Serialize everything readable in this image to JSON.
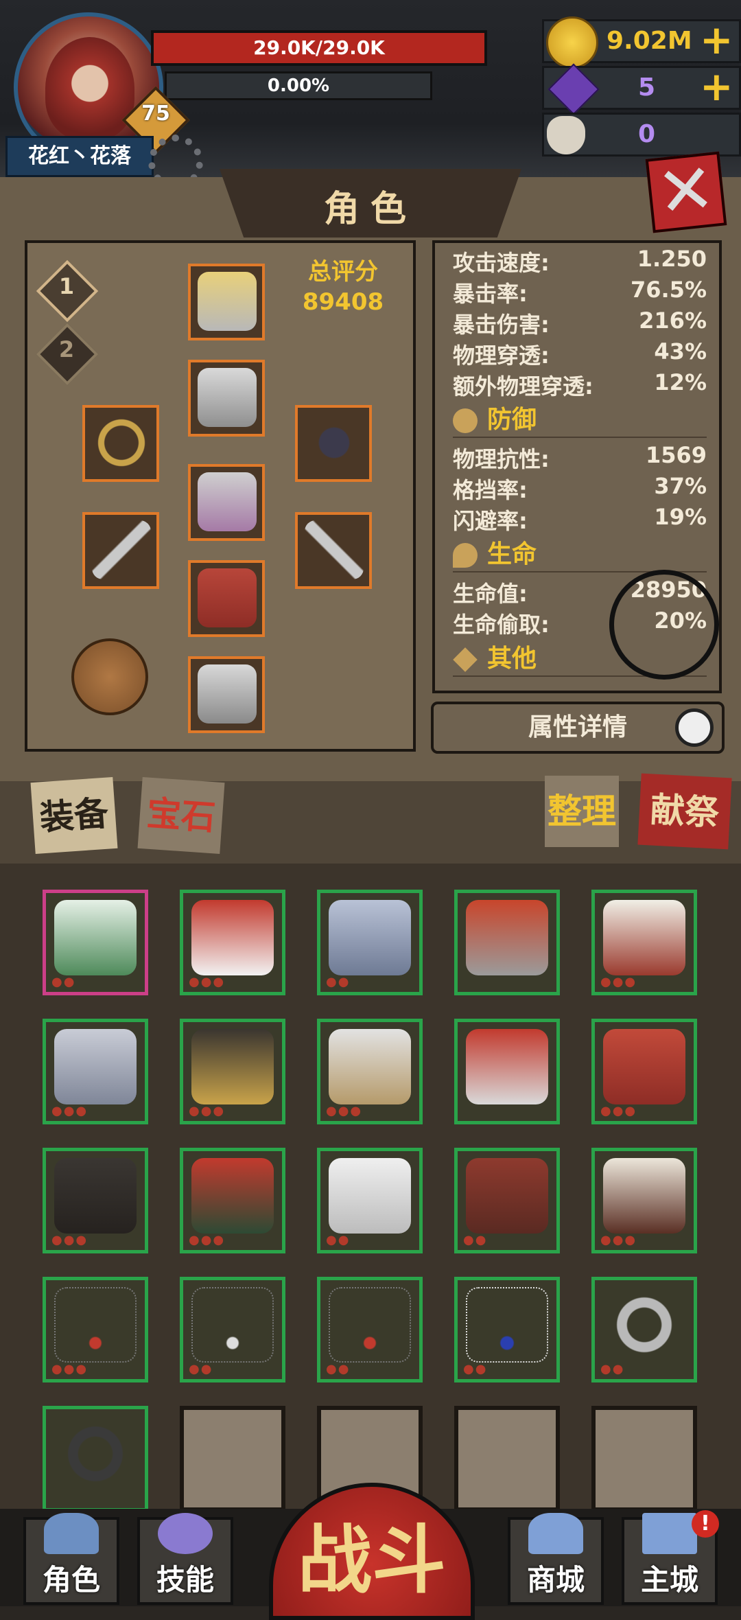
{
  "hud": {
    "player_name": "花红丶花落",
    "level": "75",
    "hp_text": "29.0K/29.0K",
    "xp_text": "0.00%",
    "gold": "9.02M",
    "gems": "5",
    "skulls": "0"
  },
  "panel": {
    "title": "角色",
    "slot_buttons": [
      "1",
      "2"
    ],
    "score_label": "总评分",
    "score_value": "89408"
  },
  "stats": {
    "rows_attack": [
      {
        "label": "攻击速度:",
        "value": "1.250"
      },
      {
        "label": "暴击率:",
        "value": "76.5%"
      },
      {
        "label": "暴击伤害:",
        "value": "216%"
      },
      {
        "label": "物理穿透:",
        "value": "43%"
      },
      {
        "label": "额外物理穿透:",
        "value": "12%"
      }
    ],
    "defense_title": "防御",
    "rows_defense": [
      {
        "label": "物理抗性:",
        "value": "1569"
      },
      {
        "label": "格挡率:",
        "value": "37%"
      },
      {
        "label": "闪避率:",
        "value": "19%"
      }
    ],
    "life_title": "生命",
    "rows_life": [
      {
        "label": "生命值:",
        "value": "28950"
      },
      {
        "label": "生命偷取:",
        "value": "20%"
      }
    ],
    "other_title": "其他",
    "detail_button": "属性详情"
  },
  "tabs": {
    "equip": "装备",
    "gem": "宝石",
    "sort": "整理",
    "sacrifice": "献祭"
  },
  "inventory_icons": [
    "winter-boots-icon",
    "santa-hat-icon",
    "knight-helmet-icon",
    "roman-helmet-icon",
    "red-coat-icon",
    "chainmail-icon",
    "black-jacket-icon",
    "plate-armor-icon",
    "roman-armor-icon",
    "red-belt-icon",
    "black-pants-icon",
    "red-skirt-icon",
    "white-pants-icon",
    "leather-skirt-icon",
    "snow-boots-icon",
    "necklace-icon",
    "necklace-icon",
    "necklace-icon",
    "heart-necklace-icon",
    "diamond-ring-icon",
    "black-ring-icon",
    "",
    "",
    "",
    ""
  ],
  "nav": {
    "role": "角色",
    "skill": "技能",
    "battle": "战斗",
    "shop": "商城",
    "city": "主城",
    "alert": "!"
  },
  "colors": {
    "accent_gold": "#f2c530",
    "hp_red": "#b3271f",
    "item_green": "#2aa44a",
    "item_rare_pink": "#cc3f88",
    "equip_orange": "#e07a2a"
  }
}
